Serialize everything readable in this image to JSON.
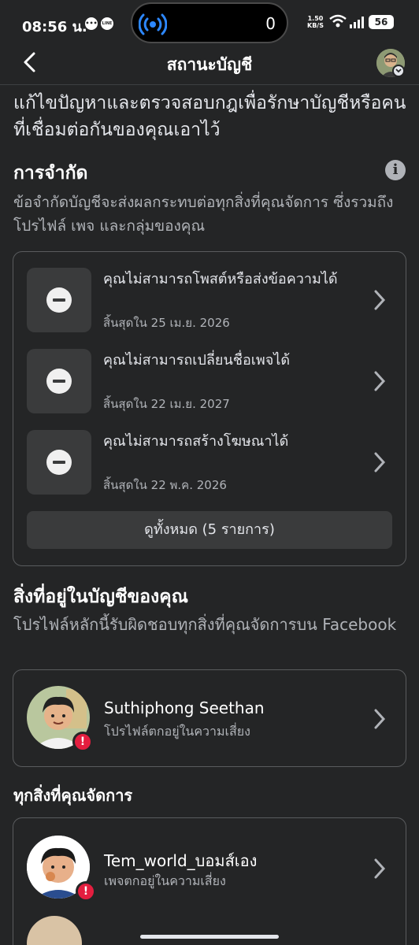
{
  "status_bar": {
    "time": "08:56 น.",
    "island_count": "0",
    "speed_value": "1.50",
    "speed_unit": "KB/S",
    "battery": "56",
    "app_icon_line": "LINE"
  },
  "nav": {
    "title": "สถานะบัญชี"
  },
  "intro": {
    "text": "แก้ไขปัญหาและตรวจสอบกฎเพื่อรักษาบัญชีหรือคนที่เชื่อมต่อกันของคุณเอาไว้"
  },
  "restrictions": {
    "title": "การจำกัด",
    "subtitle": "ข้อจำกัดบัญชีจะส่งผลกระทบต่อทุกสิ่งที่คุณจัดการ ซึ่งรวมถึงโปรไฟล์ เพจ และกลุ่มของคุณ",
    "items": [
      {
        "label": "คุณไม่สามารถโพสต์หรือส่งข้อความได้",
        "date": "สิ้นสุดใน 25 เม.ย. 2026"
      },
      {
        "label": "คุณไม่สามารถเปลี่ยนชื่อเพจได้",
        "date": "สิ้นสุดใน 22 เม.ย. 2027"
      },
      {
        "label": "คุณไม่สามารถสร้างโฆษณาได้",
        "date": "สิ้นสุดใน 22 พ.ค. 2026"
      }
    ],
    "see_all": "ดูทั้งหมด (5 รายการ)"
  },
  "in_account": {
    "title": "สิ่งที่อยู่ในบัญชีของคุณ",
    "subtitle": "โปรไฟล์หลักนี้รับผิดชอบทุกสิ่งที่คุณจัดการบน Facebook",
    "profile": {
      "name": "Suthiphong Seethan",
      "status": "โปรไฟล์ตกอยู่ในความเสี่ยง"
    }
  },
  "managed": {
    "title": "ทุกสิ่งที่คุณจัดการ",
    "items": [
      {
        "name": "Tem_world_บอมส์เอง",
        "status": "เพจตกอยู่ในความเสี่ยง"
      }
    ]
  },
  "colors": {
    "background": "#242526",
    "alert": "#e41e3f",
    "island_accent": "#2d88ff"
  }
}
